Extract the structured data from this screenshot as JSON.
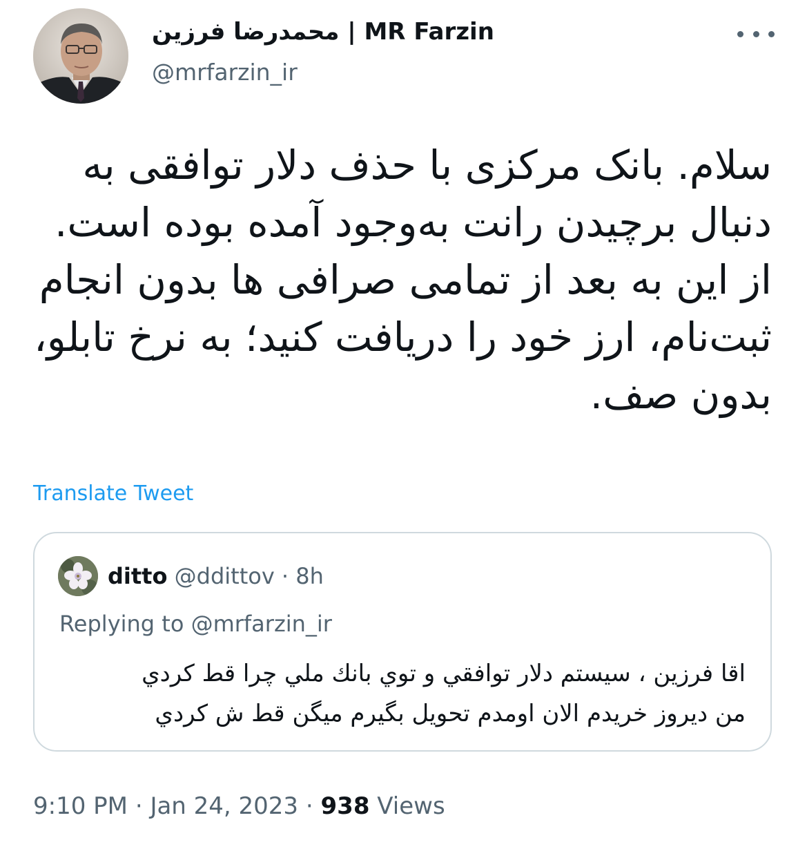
{
  "author": {
    "display_name": "محمدرضا فرزین | MR Farzin",
    "handle": "@mrfarzin_ir",
    "avatar_icon": "profile-photo"
  },
  "more_icon": "more-horizontal-icon",
  "tweet": {
    "paragraphs": [
      "سلام. بانک مرکزی با حذف دلار توافقی به دنبال برچیدن رانت به‌وجود آمده بوده است.",
      "از این به بعد از تمامی صرافی ها بدون انجام ثبت‌نام، ارز خود را دریافت کنید؛ به نرخ تابلو، بدون صف."
    ],
    "translate_label": "Translate Tweet"
  },
  "quoted_tweet": {
    "name": "ditto",
    "handle": "@ddittov",
    "separator": "·",
    "time": "8h",
    "avatar_icon": "flower-photo",
    "replying_label": "Replying to @mrfarzin_ir",
    "lines": [
      "اقا فرزين ، سيستم دلار توافقي و توي بانك ملي چرا قط كردي",
      "من ديروز خريدم الان اومدم تحويل بگيرم ميگن قط ش كردي"
    ]
  },
  "meta": {
    "time": "9:10 PM",
    "separator": "·",
    "date": "Jan 24, 2023",
    "views_count": "938",
    "views_label": "Views"
  },
  "colors": {
    "text": "#0f1419",
    "secondary": "#536471",
    "link": "#1d9bf0",
    "border": "#cfd9de"
  }
}
